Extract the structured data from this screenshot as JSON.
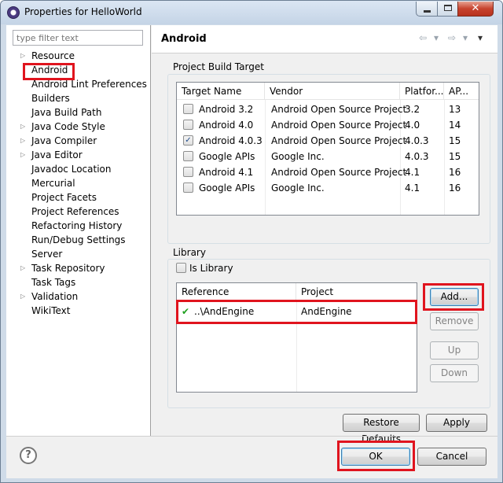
{
  "window": {
    "title": "Properties for HelloWorld",
    "close_glyph": "✕"
  },
  "filter": {
    "placeholder": "type filter text"
  },
  "tree": [
    {
      "label": "Resource",
      "expandable": true
    },
    {
      "label": "Android",
      "expandable": false,
      "highlighted": true
    },
    {
      "label": "Android Lint Preferences",
      "expandable": false
    },
    {
      "label": "Builders",
      "expandable": false
    },
    {
      "label": "Java Build Path",
      "expandable": false
    },
    {
      "label": "Java Code Style",
      "expandable": true
    },
    {
      "label": "Java Compiler",
      "expandable": true
    },
    {
      "label": "Java Editor",
      "expandable": true
    },
    {
      "label": "Javadoc Location",
      "expandable": false
    },
    {
      "label": "Mercurial",
      "expandable": false
    },
    {
      "label": "Project Facets",
      "expandable": false
    },
    {
      "label": "Project References",
      "expandable": false
    },
    {
      "label": "Refactoring History",
      "expandable": false
    },
    {
      "label": "Run/Debug Settings",
      "expandable": false
    },
    {
      "label": "Server",
      "expandable": false
    },
    {
      "label": "Task Repository",
      "expandable": true
    },
    {
      "label": "Task Tags",
      "expandable": false
    },
    {
      "label": "Validation",
      "expandable": true
    },
    {
      "label": "WikiText",
      "expandable": false
    }
  ],
  "page": {
    "title": "Android",
    "nav": {
      "back": "⇦",
      "forward": "⇨",
      "dropdown": "▾",
      "menu": "▾"
    }
  },
  "build_target": {
    "group_label": "Project Build Target",
    "columns": [
      "Target Name",
      "Vendor",
      "Platfor...",
      "AP..."
    ],
    "rows": [
      {
        "checked": false,
        "name": "Android 3.2",
        "vendor": "Android Open Source Project",
        "platform": "3.2",
        "api": "13"
      },
      {
        "checked": false,
        "name": "Android 4.0",
        "vendor": "Android Open Source Project",
        "platform": "4.0",
        "api": "14"
      },
      {
        "checked": true,
        "name": "Android 4.0.3",
        "vendor": "Android Open Source Project",
        "platform": "4.0.3",
        "api": "15"
      },
      {
        "checked": false,
        "name": "Google APIs",
        "vendor": "Google Inc.",
        "platform": "4.0.3",
        "api": "15"
      },
      {
        "checked": false,
        "name": "Android 4.1",
        "vendor": "Android Open Source Project",
        "platform": "4.1",
        "api": "16"
      },
      {
        "checked": false,
        "name": "Google APIs",
        "vendor": "Google Inc.",
        "platform": "4.1",
        "api": "16"
      }
    ],
    "check_glyph": "✓"
  },
  "library": {
    "group_label": "Library",
    "is_library_label": "Is Library",
    "is_library_checked": false,
    "columns": [
      "Reference",
      "Project"
    ],
    "rows": [
      {
        "status_glyph": "✔",
        "reference": "..\\AndEngine",
        "project": "AndEngine"
      }
    ],
    "buttons": {
      "add": "Add...",
      "remove": "Remove",
      "up": "Up",
      "down": "Down"
    }
  },
  "page_buttons": {
    "restore_defaults": "Restore Defaults",
    "apply": "Apply"
  },
  "dialog_buttons": {
    "help": "?",
    "ok": "OK",
    "cancel": "Cancel"
  },
  "colors": {
    "highlight": "#e0141e",
    "check_green": "#20a020"
  }
}
